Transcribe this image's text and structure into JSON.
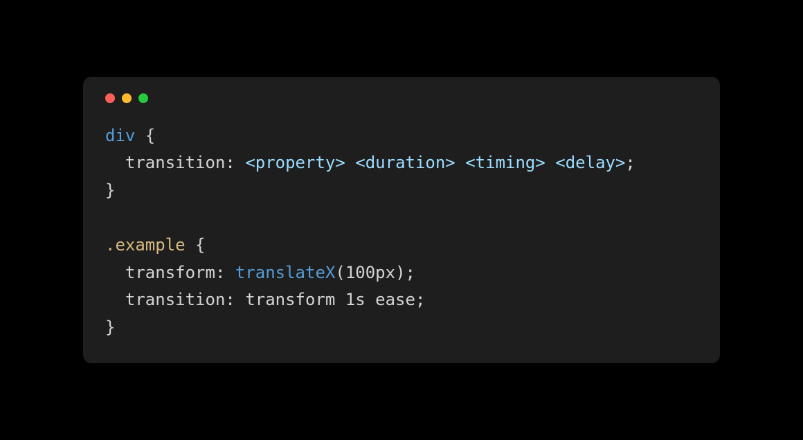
{
  "window": {
    "controls": {
      "close": "close",
      "minimize": "minimize",
      "maximize": "maximize"
    }
  },
  "code": {
    "line1": {
      "selector": "div",
      "brace_open": " {"
    },
    "line2": {
      "indent": "  ",
      "property": "transition",
      "colon": ": ",
      "ph_property": "<property>",
      "sp1": " ",
      "ph_duration": "<duration>",
      "sp2": " ",
      "ph_timing": "<timing>",
      "sp3": " ",
      "ph_delay": "<delay>",
      "semi": ";"
    },
    "line3": {
      "brace_close": "}"
    },
    "line4": {
      "blank": ""
    },
    "line5": {
      "selector": ".example",
      "brace_open": " {"
    },
    "line6": {
      "indent": "  ",
      "property": "transform",
      "colon": ": ",
      "func": "translateX",
      "paren_open": "(",
      "arg": "100px",
      "paren_close": ")",
      "semi": ";"
    },
    "line7": {
      "indent": "  ",
      "property": "transition",
      "colon": ": ",
      "value": "transform 1s ease",
      "semi": ";"
    },
    "line8": {
      "brace_close": "}"
    }
  }
}
